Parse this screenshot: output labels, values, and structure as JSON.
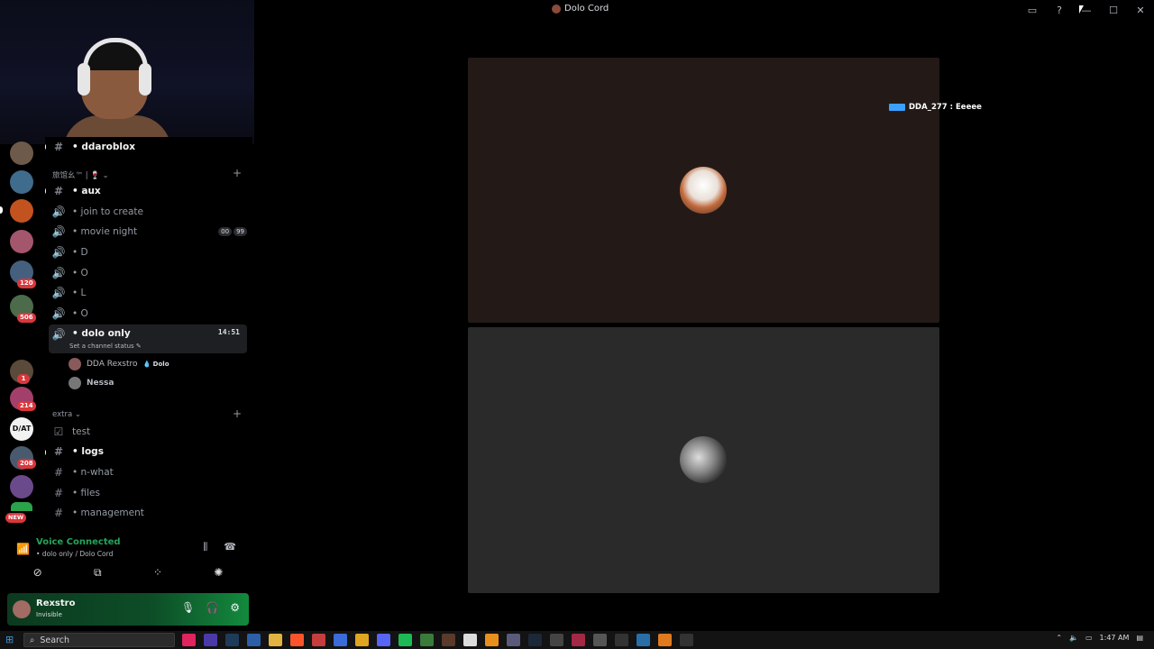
{
  "window": {
    "title": "Dolo Cord",
    "icons": [
      "inbox-icon",
      "help-icon",
      "minimize-icon",
      "maximize-icon",
      "close-icon"
    ]
  },
  "servers": {
    "badges": [
      "1",
      "120",
      "506",
      "1",
      "214",
      "208"
    ],
    "new_label": "NEW",
    "logo_text": "D/AT"
  },
  "channels": {
    "top_channel": "• ddaroblox",
    "category1": "旅馆幺™ | 🍷 ⌄",
    "category2": "extra ⌄",
    "items": [
      {
        "label": "• aux",
        "icon": "#"
      },
      {
        "label": "• join to create",
        "icon": "🔊"
      },
      {
        "label": "• movie night",
        "icon": "🔊",
        "pill_a": "00",
        "pill_b": "99"
      },
      {
        "label": "• D",
        "icon": "🔊"
      },
      {
        "label": "• O",
        "icon": "🔊"
      },
      {
        "label": "• L",
        "icon": "🔊"
      },
      {
        "label": "• O",
        "icon": "🔊"
      }
    ],
    "active": {
      "label": "• dolo only",
      "time": "14:51",
      "status": "Set a channel status ✎"
    },
    "voice_users": [
      {
        "name": "DDA Rexstro",
        "tag": "💧 Dolo"
      },
      {
        "name": "Nessa"
      }
    ],
    "extra_items": [
      {
        "label": "test",
        "icon": "☑"
      },
      {
        "label": "• logs",
        "icon": "#"
      },
      {
        "label": "• n-what",
        "icon": "#"
      },
      {
        "label": "• files",
        "icon": "#"
      },
      {
        "label": "• management",
        "icon": "#"
      }
    ],
    "plus": "+"
  },
  "voice": {
    "title": "Voice Connected",
    "subtitle": "• dolo only / Dolo Cord"
  },
  "user": {
    "name": "Rexstro",
    "status": "Invisible"
  },
  "stage": {
    "chat_overlay": "DDA_277 : Eeeee"
  },
  "taskbar": {
    "search_placeholder": "Search",
    "time": "1:47 AM"
  },
  "colors": {
    "voice_green": "#23a55a",
    "badge_red": "#da373c",
    "tile1_bg": "#231a18",
    "tile2_bg": "#2a2a2a"
  }
}
